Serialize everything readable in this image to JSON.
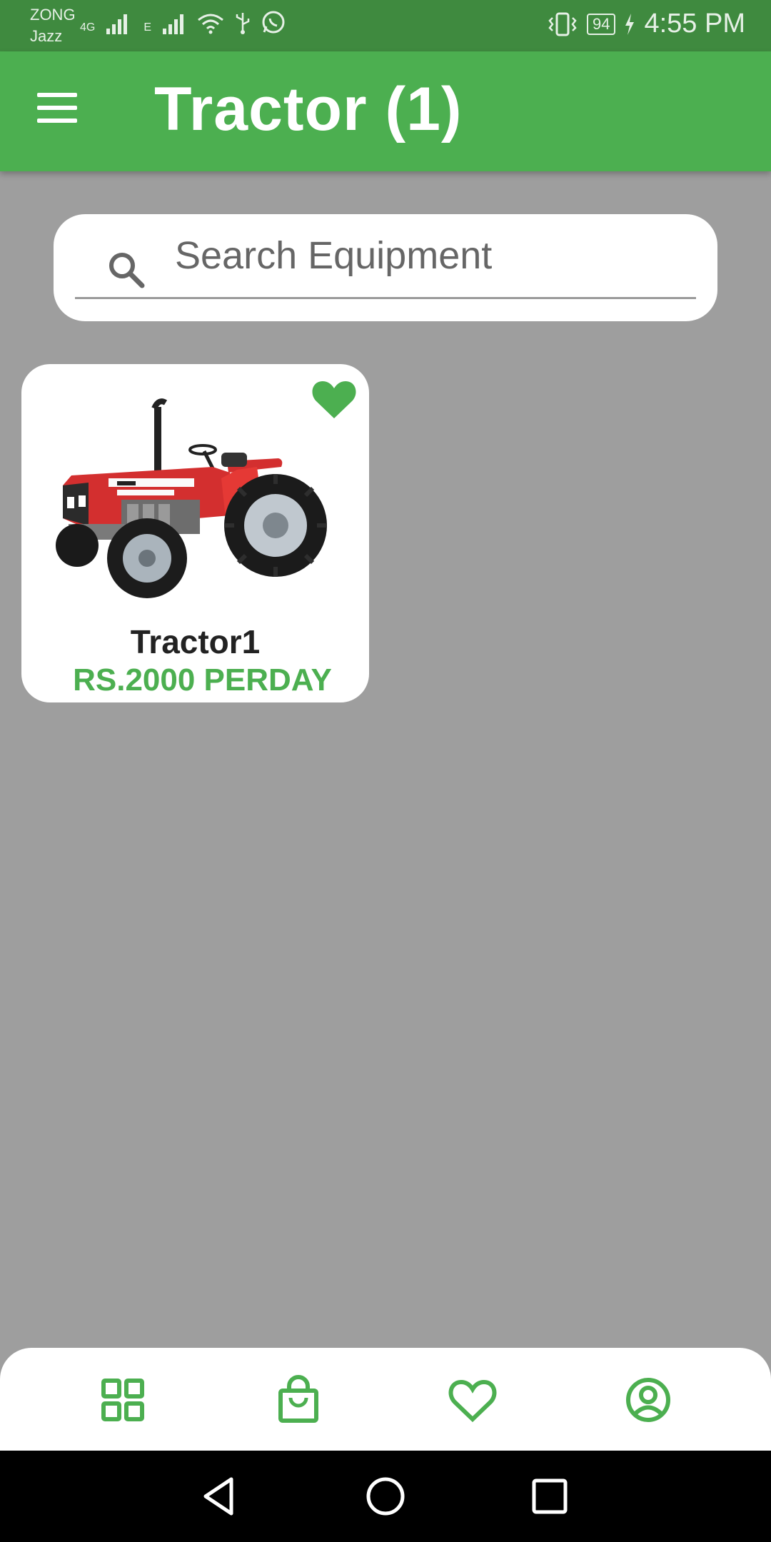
{
  "status_bar": {
    "carrier_top": "ZONG",
    "carrier_bottom": "Jazz",
    "network_1": "4G",
    "network_2": "E",
    "battery": "94",
    "time": "4:55 PM"
  },
  "app_bar": {
    "title": "Tractor (1)",
    "menu_icon": "menu-icon"
  },
  "search": {
    "placeholder": "Search Equipment",
    "value": ""
  },
  "products": [
    {
      "name": "Tractor1",
      "price": "RS.2000 PERDAY",
      "favorite": true
    }
  ],
  "bottom_nav": {
    "items": [
      "grid-icon",
      "shopping-bag-icon",
      "heart-icon",
      "profile-icon"
    ]
  },
  "colors": {
    "primary": "#4caf50",
    "status_bar": "#3f8a3f",
    "background": "#9e9e9e"
  }
}
